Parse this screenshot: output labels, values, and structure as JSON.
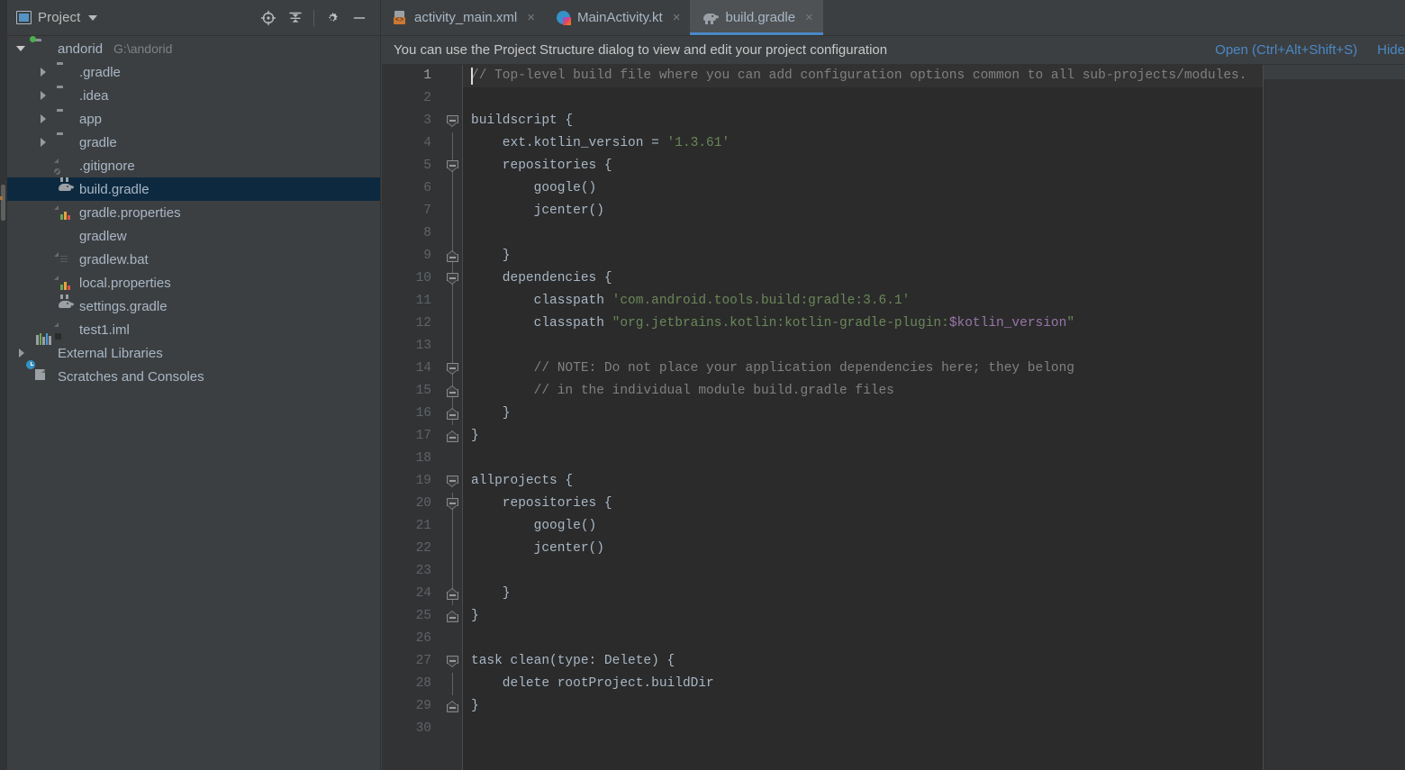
{
  "window": {
    "theme_bg": "#3c3f41",
    "editor_bg": "#2b2b2b",
    "accent": "#4a88c7",
    "selection_bg": "#0d293f"
  },
  "project_panel": {
    "title": "Project",
    "title_icon": "project-view-icon",
    "tools": [
      {
        "name": "locate-target-icon",
        "title": "Select Opened File"
      },
      {
        "name": "collapse-all-icon",
        "title": "Collapse All"
      },
      {
        "name": "gear-icon",
        "title": "Settings"
      },
      {
        "name": "minimize-icon",
        "title": "Hide"
      }
    ],
    "tree": [
      {
        "label": "andorid",
        "sublabel": "G:\\andorid",
        "icon": "module-folder-icon",
        "arrow": "expanded",
        "indent": 0,
        "selected": false
      },
      {
        "label": ".gradle",
        "sublabel": "",
        "icon": "folder-icon",
        "arrow": "collapsed",
        "indent": 1,
        "selected": false
      },
      {
        "label": ".idea",
        "sublabel": "",
        "icon": "folder-icon",
        "arrow": "collapsed",
        "indent": 1,
        "selected": false
      },
      {
        "label": "app",
        "sublabel": "",
        "icon": "folder-icon",
        "arrow": "collapsed",
        "indent": 1,
        "selected": false
      },
      {
        "label": "gradle",
        "sublabel": "",
        "icon": "folder-icon",
        "arrow": "collapsed",
        "indent": 1,
        "selected": false
      },
      {
        "label": ".gitignore",
        "sublabel": "",
        "icon": "gitignore-file-icon",
        "arrow": "none",
        "indent": 1,
        "selected": false
      },
      {
        "label": "build.gradle",
        "sublabel": "",
        "icon": "gradle-file-icon",
        "arrow": "none",
        "indent": 1,
        "selected": true
      },
      {
        "label": "gradle.properties",
        "sublabel": "",
        "icon": "properties-file-icon",
        "arrow": "none",
        "indent": 1,
        "selected": false
      },
      {
        "label": "gradlew",
        "sublabel": "",
        "icon": "shell-script-icon",
        "arrow": "none",
        "indent": 1,
        "selected": false
      },
      {
        "label": "gradlew.bat",
        "sublabel": "",
        "icon": "batch-file-icon",
        "arrow": "none",
        "indent": 1,
        "selected": false
      },
      {
        "label": "local.properties",
        "sublabel": "",
        "icon": "properties-file-icon",
        "arrow": "none",
        "indent": 1,
        "selected": false
      },
      {
        "label": "settings.gradle",
        "sublabel": "",
        "icon": "gradle-file-icon",
        "arrow": "none",
        "indent": 1,
        "selected": false
      },
      {
        "label": "test1.iml",
        "sublabel": "",
        "icon": "iml-file-icon",
        "arrow": "none",
        "indent": 1,
        "selected": false
      },
      {
        "label": "External Libraries",
        "sublabel": "",
        "icon": "external-libraries-icon",
        "arrow": "collapsed",
        "indent": 0,
        "selected": false
      },
      {
        "label": "Scratches and Consoles",
        "sublabel": "",
        "icon": "scratches-icon",
        "arrow": "none",
        "indent": 0,
        "selected": false
      }
    ]
  },
  "tabs": [
    {
      "label": "activity_main.xml",
      "icon": "android-layout-xml-icon",
      "active": false,
      "close": "×"
    },
    {
      "label": "MainActivity.kt",
      "icon": "kotlin-file-icon",
      "active": false,
      "close": "×"
    },
    {
      "label": "build.gradle",
      "icon": "gradle-file-icon",
      "active": true,
      "close": "×"
    }
  ],
  "notification": {
    "message": "You can use the Project Structure dialog to view and edit your project configuration",
    "actions": [
      {
        "label": "Open (Ctrl+Alt+Shift+S)"
      },
      {
        "label": "Hide"
      }
    ]
  },
  "editor": {
    "file": "build.gradle",
    "current_line": 1,
    "total_lines": 30,
    "line_numbers": [
      "1",
      "2",
      "3",
      "4",
      "5",
      "6",
      "7",
      "8",
      "9",
      "10",
      "11",
      "12",
      "13",
      "14",
      "15",
      "16",
      "17",
      "18",
      "19",
      "20",
      "21",
      "22",
      "23",
      "24",
      "25",
      "26",
      "27",
      "28",
      "29",
      "30"
    ],
    "lines": [
      {
        "n": 1,
        "cur": true,
        "caret": true,
        "fold": "none",
        "guide": false,
        "tokens": [
          {
            "t": "// Top-level build file where you can add configuration options common to all sub-projects/modules.",
            "c": "c-comment"
          }
        ]
      },
      {
        "n": 2,
        "cur": false,
        "caret": false,
        "fold": "none",
        "guide": false,
        "tokens": [
          {
            "t": "",
            "c": "c-plain"
          }
        ]
      },
      {
        "n": 3,
        "cur": false,
        "caret": false,
        "fold": "down",
        "guide": false,
        "tokens": [
          {
            "t": "buildscript {",
            "c": "c-plain"
          }
        ]
      },
      {
        "n": 4,
        "cur": false,
        "caret": false,
        "fold": "none",
        "guide": true,
        "tokens": [
          {
            "t": "    ext.kotlin_version = ",
            "c": "c-plain"
          },
          {
            "t": "'1.3.61'",
            "c": "c-str"
          }
        ]
      },
      {
        "n": 5,
        "cur": false,
        "caret": false,
        "fold": "down2",
        "guide": true,
        "tokens": [
          {
            "t": "    repositories {",
            "c": "c-plain"
          }
        ]
      },
      {
        "n": 6,
        "cur": false,
        "caret": false,
        "fold": "none",
        "guide": true,
        "tokens": [
          {
            "t": "        google()",
            "c": "c-plain"
          }
        ]
      },
      {
        "n": 7,
        "cur": false,
        "caret": false,
        "fold": "none",
        "guide": true,
        "tokens": [
          {
            "t": "        jcenter()",
            "c": "c-plain"
          }
        ]
      },
      {
        "n": 8,
        "cur": false,
        "caret": false,
        "fold": "none",
        "guide": true,
        "tokens": [
          {
            "t": "",
            "c": "c-plain"
          }
        ]
      },
      {
        "n": 9,
        "cur": false,
        "caret": false,
        "fold": "up2",
        "guide": true,
        "tokens": [
          {
            "t": "    }",
            "c": "c-plain"
          }
        ]
      },
      {
        "n": 10,
        "cur": false,
        "caret": false,
        "fold": "down2",
        "guide": true,
        "tokens": [
          {
            "t": "    dependencies {",
            "c": "c-plain"
          }
        ]
      },
      {
        "n": 11,
        "cur": false,
        "caret": false,
        "fold": "none",
        "guide": true,
        "tokens": [
          {
            "t": "        classpath ",
            "c": "c-plain"
          },
          {
            "t": "'com.android.tools.build:gradle:3.6.1'",
            "c": "c-str"
          }
        ]
      },
      {
        "n": 12,
        "cur": false,
        "caret": false,
        "fold": "none",
        "guide": true,
        "tokens": [
          {
            "t": "        classpath ",
            "c": "c-plain"
          },
          {
            "t": "\"org.jetbrains.kotlin:kotlin-gradle-plugin:",
            "c": "c-str"
          },
          {
            "t": "$kotlin_version",
            "c": "c-var"
          },
          {
            "t": "\"",
            "c": "c-str"
          }
        ]
      },
      {
        "n": 13,
        "cur": false,
        "caret": false,
        "fold": "none",
        "guide": true,
        "tokens": [
          {
            "t": "",
            "c": "c-plain"
          }
        ]
      },
      {
        "n": 14,
        "cur": false,
        "caret": false,
        "fold": "down2",
        "guide": true,
        "tokens": [
          {
            "t": "        // NOTE: Do not place your application dependencies here; they belong",
            "c": "c-comment"
          }
        ]
      },
      {
        "n": 15,
        "cur": false,
        "caret": false,
        "fold": "up2",
        "guide": true,
        "tokens": [
          {
            "t": "        // in the individual module build.gradle files",
            "c": "c-comment"
          }
        ]
      },
      {
        "n": 16,
        "cur": false,
        "caret": false,
        "fold": "up2",
        "guide": true,
        "tokens": [
          {
            "t": "    }",
            "c": "c-plain"
          }
        ]
      },
      {
        "n": 17,
        "cur": false,
        "caret": false,
        "fold": "up",
        "guide": false,
        "tokens": [
          {
            "t": "}",
            "c": "c-plain"
          }
        ]
      },
      {
        "n": 18,
        "cur": false,
        "caret": false,
        "fold": "none",
        "guide": false,
        "tokens": [
          {
            "t": "",
            "c": "c-plain"
          }
        ]
      },
      {
        "n": 19,
        "cur": false,
        "caret": false,
        "fold": "down",
        "guide": false,
        "tokens": [
          {
            "t": "allprojects {",
            "c": "c-plain"
          }
        ]
      },
      {
        "n": 20,
        "cur": false,
        "caret": false,
        "fold": "down2",
        "guide": true,
        "tokens": [
          {
            "t": "    repositories {",
            "c": "c-plain"
          }
        ]
      },
      {
        "n": 21,
        "cur": false,
        "caret": false,
        "fold": "none",
        "guide": true,
        "tokens": [
          {
            "t": "        google()",
            "c": "c-plain"
          }
        ]
      },
      {
        "n": 22,
        "cur": false,
        "caret": false,
        "fold": "none",
        "guide": true,
        "tokens": [
          {
            "t": "        jcenter()",
            "c": "c-plain"
          }
        ]
      },
      {
        "n": 23,
        "cur": false,
        "caret": false,
        "fold": "none",
        "guide": true,
        "tokens": [
          {
            "t": "",
            "c": "c-plain"
          }
        ]
      },
      {
        "n": 24,
        "cur": false,
        "caret": false,
        "fold": "up2",
        "guide": true,
        "tokens": [
          {
            "t": "    }",
            "c": "c-plain"
          }
        ]
      },
      {
        "n": 25,
        "cur": false,
        "caret": false,
        "fold": "up",
        "guide": false,
        "tokens": [
          {
            "t": "}",
            "c": "c-plain"
          }
        ]
      },
      {
        "n": 26,
        "cur": false,
        "caret": false,
        "fold": "none",
        "guide": false,
        "tokens": [
          {
            "t": "",
            "c": "c-plain"
          }
        ]
      },
      {
        "n": 27,
        "cur": false,
        "caret": false,
        "fold": "down",
        "guide": false,
        "tokens": [
          {
            "t": "task clean(type: Delete) {",
            "c": "c-plain"
          }
        ]
      },
      {
        "n": 28,
        "cur": false,
        "caret": false,
        "fold": "none",
        "guide": true,
        "tokens": [
          {
            "t": "    delete rootProject.buildDir",
            "c": "c-plain"
          }
        ]
      },
      {
        "n": 29,
        "cur": false,
        "caret": false,
        "fold": "up",
        "guide": false,
        "tokens": [
          {
            "t": "}",
            "c": "c-plain"
          }
        ]
      },
      {
        "n": 30,
        "cur": false,
        "caret": false,
        "fold": "none",
        "guide": false,
        "tokens": [
          {
            "t": "",
            "c": "c-plain"
          }
        ]
      }
    ]
  }
}
